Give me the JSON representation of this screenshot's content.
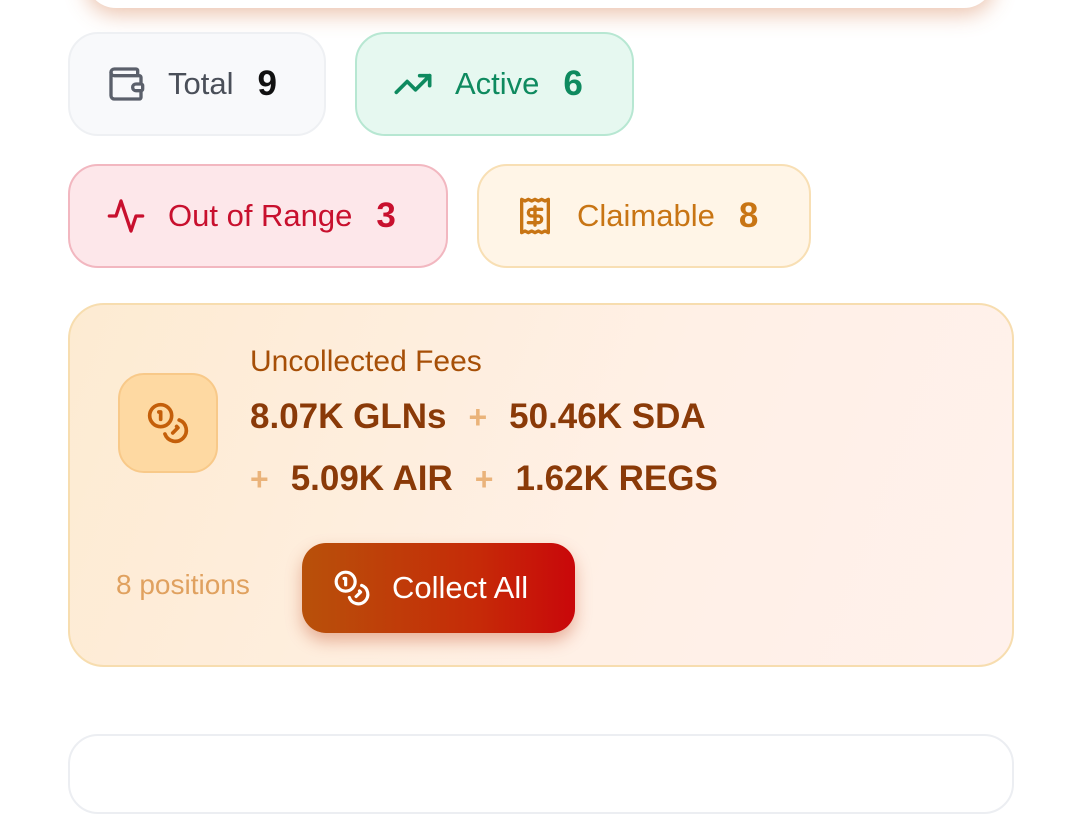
{
  "stats": {
    "total": {
      "label": "Total",
      "count": "9",
      "icon": "wallet-icon"
    },
    "active": {
      "label": "Active",
      "count": "6",
      "icon": "trending-up-icon"
    },
    "out_of_range": {
      "label": "Out of Range",
      "count": "3",
      "icon": "activity-icon"
    },
    "claimable": {
      "label": "Claimable",
      "count": "8",
      "icon": "receipt-dollar-icon"
    }
  },
  "fees": {
    "title": "Uncollected Fees",
    "icon": "coins-icon",
    "amounts": [
      "8.07K GLNs",
      "50.46K SDA",
      "5.09K AIR",
      "1.62K REGS"
    ],
    "separator": "+",
    "positions": "8 positions",
    "collect_label": "Collect All"
  },
  "colors": {
    "active": "#0e8a5f",
    "out_of_range": "#c8102e",
    "claimable": "#c87514",
    "fees_text": "#8a3a08",
    "button_start": "#b8510a",
    "button_end": "#c9070a"
  }
}
